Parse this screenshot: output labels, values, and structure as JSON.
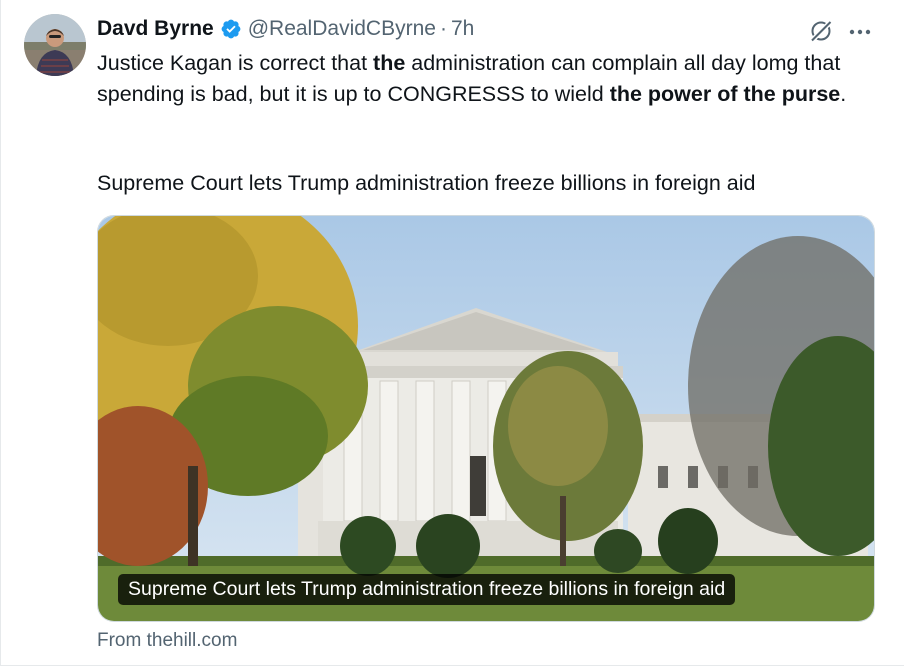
{
  "author": {
    "display_name": "Davd Byrne",
    "handle": "@RealDavidCByrne",
    "separator": "·",
    "time": "7h",
    "verified": true,
    "badge_color": "#1d9bf0"
  },
  "tweet": {
    "segments": [
      {
        "text": "Justice Kagan is correct that ",
        "bold": false
      },
      {
        "text": "the",
        "bold": true
      },
      {
        "text": " administration can complain all day lomg that spending is bad, but it is up to CONGRESSS to wield ",
        "bold": false
      },
      {
        "text": "the power of the purse",
        "bold": true
      },
      {
        "text": ".",
        "bold": false
      }
    ],
    "link_headline": "Supreme Court lets Trump administration freeze billions in foreign aid"
  },
  "card": {
    "image_icon": "supreme-court-photo",
    "caption": "Supreme Court lets Trump administration freeze billions in foreign aid",
    "source": "From thehill.com"
  },
  "icons": {
    "verified": "verified-badge-icon",
    "grok": "grok-icon",
    "more": "more-options-icon"
  },
  "colors": {
    "text": "#0f1419",
    "secondary": "#536471",
    "border": "#cfd9de"
  }
}
